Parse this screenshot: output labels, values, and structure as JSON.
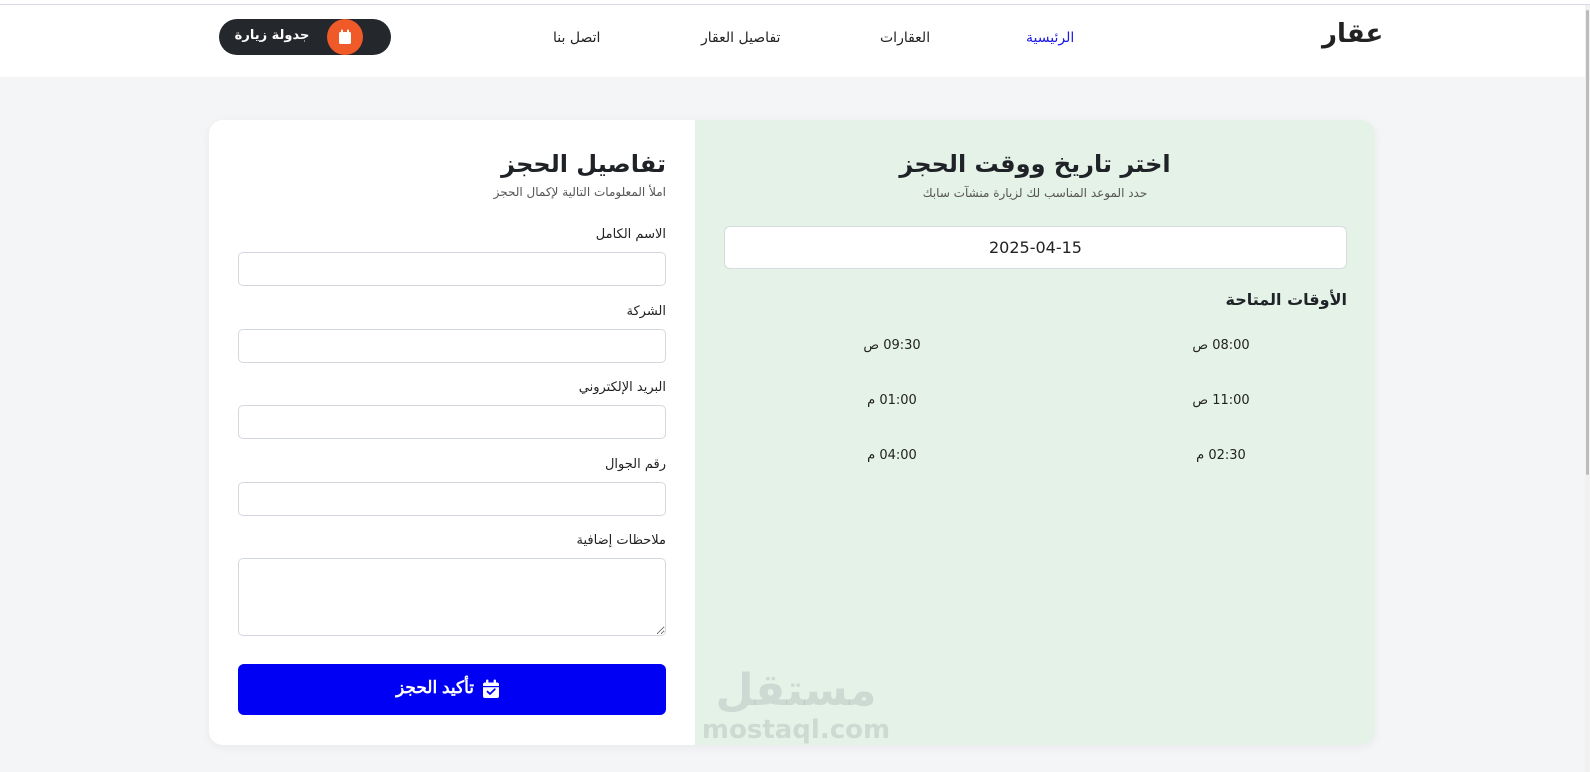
{
  "navbar": {
    "logo": "عقار",
    "links": [
      "الرئيسية",
      "العقارات",
      "تفاصيل العقار",
      "اتصل بنا"
    ],
    "cta_label": "جدولة زيارة",
    "accent_color": "#1a16e8"
  },
  "schedule": {
    "title": "اختر تاريخ ووقت الحجز",
    "subtitle": "حدد الموعد المناسب لك لزيارة منشآت سابك",
    "date_value": "2025-04-15",
    "times_heading": "الأوقات المتاحة",
    "slots": [
      "08:00 ص",
      "09:30 ص",
      "11:00 ص",
      "01:00 م",
      "02:30 م",
      "04:00 م"
    ]
  },
  "form": {
    "title": "تفاصيل الحجز",
    "subtitle": "املأ المعلومات التالية لإكمال الحجز",
    "fields": {
      "full_name": "الاسم الكامل",
      "company": "الشركة",
      "email": "البريد الإلكتروني",
      "phone": "رقم الجوال",
      "notes": "ملاحظات إضافية"
    },
    "submit_label": "تأكيد الحجز",
    "submit_color": "#0000f4"
  },
  "watermark": {
    "arabic": "مستقل",
    "latin": "mostaql.com"
  }
}
